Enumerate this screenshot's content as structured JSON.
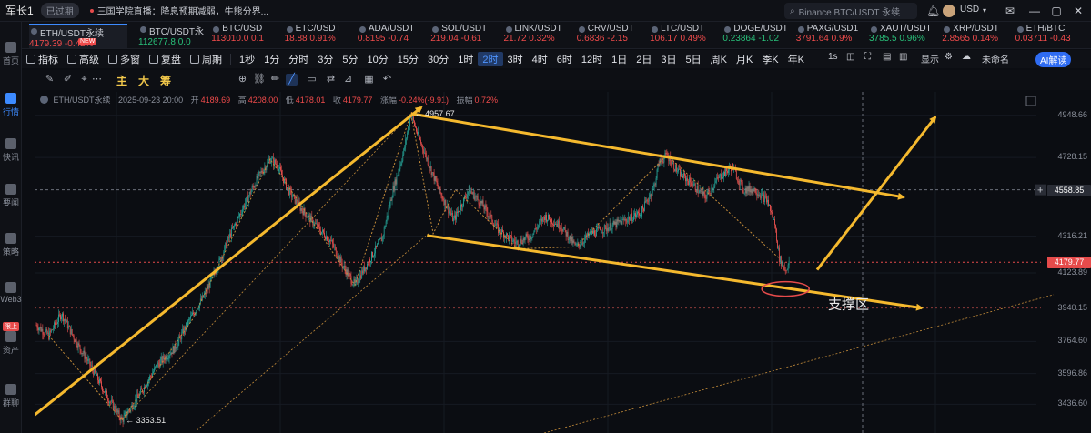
{
  "window": {
    "title": "军长1",
    "status": "已过期",
    "news": "三国学院直播：降息预期减弱，牛熊分界...",
    "search_placeholder": "Binance BTC/USDT 永续",
    "currency": "USD"
  },
  "leftnav": [
    {
      "label": "首页",
      "active": false
    },
    {
      "label": "行情",
      "active": true
    },
    {
      "label": "快讯",
      "active": false
    },
    {
      "label": "要闻",
      "active": false
    },
    {
      "label": "策略",
      "active": false
    },
    {
      "label": "Web3",
      "active": false
    },
    {
      "label": "资产",
      "active": false,
      "badge": "限上"
    },
    {
      "label": "群聊",
      "active": false
    }
  ],
  "tickers": [
    {
      "symbol": "ETH/USDT永续",
      "price": "4179.39",
      "change": "-0.42%",
      "dir": "down",
      "badge": "NEW",
      "active": true
    },
    {
      "symbol": "BTC/USDT永",
      "price": "112677.8",
      "change": "0.0",
      "dir": "up"
    },
    {
      "symbol": "BTC/USD",
      "price": "113010.0",
      "change": "0.1",
      "dir": "down"
    },
    {
      "symbol": "ETC/USDT",
      "price": "18.88",
      "change": "0.91%",
      "dir": "down"
    },
    {
      "symbol": "ADA/USDT",
      "price": "0.8195",
      "change": "-0.74",
      "dir": "down"
    },
    {
      "symbol": "SOL/USDT",
      "price": "219.04",
      "change": "-0.61",
      "dir": "down"
    },
    {
      "symbol": "LINK/USDT",
      "price": "21.72",
      "change": "0.32%",
      "dir": "down"
    },
    {
      "symbol": "CRV/USDT",
      "price": "0.6836",
      "change": "-2.15",
      "dir": "down"
    },
    {
      "symbol": "LTC/USDT",
      "price": "106.17",
      "change": "0.49%",
      "dir": "down"
    },
    {
      "symbol": "DOGE/USDT",
      "price": "0.23864",
      "change": "-1.02",
      "dir": "up"
    },
    {
      "symbol": "PAXG/USD1",
      "price": "3791.64",
      "change": "0.9%",
      "dir": "down"
    },
    {
      "symbol": "XAUT/USDT",
      "price": "3785.5",
      "change": "0.96%",
      "dir": "up"
    },
    {
      "symbol": "XRP/USDT",
      "price": "2.8565",
      "change": "0.14%",
      "dir": "down"
    },
    {
      "symbol": "ETH/BTC",
      "price": "0.03711",
      "change": "-0.43",
      "dir": "down"
    }
  ],
  "toolbar": {
    "items": [
      "指标",
      "高级",
      "多窗",
      "复盘",
      "周期",
      "1秒",
      "1分",
      "分时",
      "3分",
      "5分",
      "10分",
      "15分",
      "30分",
      "1时",
      "2时",
      "3时",
      "4时",
      "6时",
      "12时",
      "1日",
      "2日",
      "3日",
      "5日",
      "周K",
      "月K",
      "季K",
      "年K"
    ],
    "selected": "2时",
    "right_1s": "1s",
    "display": "显示",
    "unnamed": "未命名",
    "ai": "AI解读"
  },
  "indicators": [
    {
      "label": "主",
      "color": "#f2c84b"
    },
    {
      "label": "大",
      "color": "#f2c84b"
    },
    {
      "label": "筹",
      "color": "#f2c84b"
    }
  ],
  "icons": [
    "ruler-icon",
    "pen-icon",
    "crosshair-icon",
    "more-dots-icon",
    "magnet-icon",
    "link-icon",
    "brush-icon",
    "line-tool-icon",
    "box-icon",
    "compare-icon",
    "filter-icon",
    "grid-icon",
    "undo-icon"
  ],
  "ohlc": {
    "pair": "ETH/USDT永续",
    "datetime": "2025-09-23 20:00",
    "open_label": "开",
    "open": "4189.69",
    "high_label": "高",
    "high": "4208.00",
    "low_label": "低",
    "low": "4178.01",
    "close_label": "收",
    "close": "4179.77",
    "chg_label": "涨幅",
    "chg": "-0.24%(-9.91)",
    "amp_label": "振幅",
    "amp": "0.72%"
  },
  "chart_data": {
    "type": "candlestick",
    "y_ticks": [
      4948.66,
      4728.15,
      4316.21,
      4123.89,
      3940.15,
      3764.6,
      3596.86,
      3436.6
    ],
    "price_tags": [
      {
        "value": "4558.85",
        "color": "#2a2d36"
      },
      {
        "value": "4179.77",
        "color": "#e64b4b"
      }
    ],
    "annotations": {
      "high": "4957.67",
      "low": "3353.51",
      "support": "支撑区"
    },
    "colors": {
      "up": "#26a69a",
      "down": "#ef5350",
      "arrow": "#f5b92e",
      "zigzag": "#c48c3a"
    },
    "waypoints": [
      [
        0,
        3850
      ],
      [
        14,
        3795
      ],
      [
        28,
        3910
      ],
      [
        45,
        3760
      ],
      [
        63,
        3620
      ],
      [
        80,
        3470
      ],
      [
        96,
        3353.51
      ],
      [
        115,
        3480
      ],
      [
        135,
        3640
      ],
      [
        155,
        3730
      ],
      [
        172,
        3880
      ],
      [
        190,
        4020
      ],
      [
        205,
        4180
      ],
      [
        218,
        4330
      ],
      [
        232,
        4470
      ],
      [
        248,
        4620
      ],
      [
        262,
        4720
      ],
      [
        270,
        4690
      ],
      [
        282,
        4560
      ],
      [
        295,
        4470
      ],
      [
        312,
        4380
      ],
      [
        330,
        4290
      ],
      [
        345,
        4150
      ],
      [
        357,
        4060
      ],
      [
        372,
        4180
      ],
      [
        388,
        4310
      ],
      [
        400,
        4560
      ],
      [
        412,
        4760
      ],
      [
        420,
        4957.67
      ],
      [
        428,
        4840
      ],
      [
        438,
        4720
      ],
      [
        452,
        4550
      ],
      [
        468,
        4400
      ],
      [
        485,
        4560
      ],
      [
        500,
        4480
      ],
      [
        518,
        4350
      ],
      [
        538,
        4280
      ],
      [
        555,
        4320
      ],
      [
        570,
        4420
      ],
      [
        588,
        4370
      ],
      [
        605,
        4260
      ],
      [
        622,
        4330
      ],
      [
        640,
        4360
      ],
      [
        660,
        4400
      ],
      [
        678,
        4440
      ],
      [
        693,
        4580
      ],
      [
        698,
        4700
      ],
      [
        707,
        4740
      ],
      [
        720,
        4650
      ],
      [
        735,
        4590
      ],
      [
        750,
        4520
      ],
      [
        765,
        4620
      ],
      [
        780,
        4680
      ],
      [
        793,
        4560
      ],
      [
        806,
        4560
      ],
      [
        820,
        4500
      ],
      [
        828,
        4380
      ],
      [
        833,
        4200
      ],
      [
        840,
        4140
      ],
      [
        845,
        4180
      ]
    ]
  }
}
